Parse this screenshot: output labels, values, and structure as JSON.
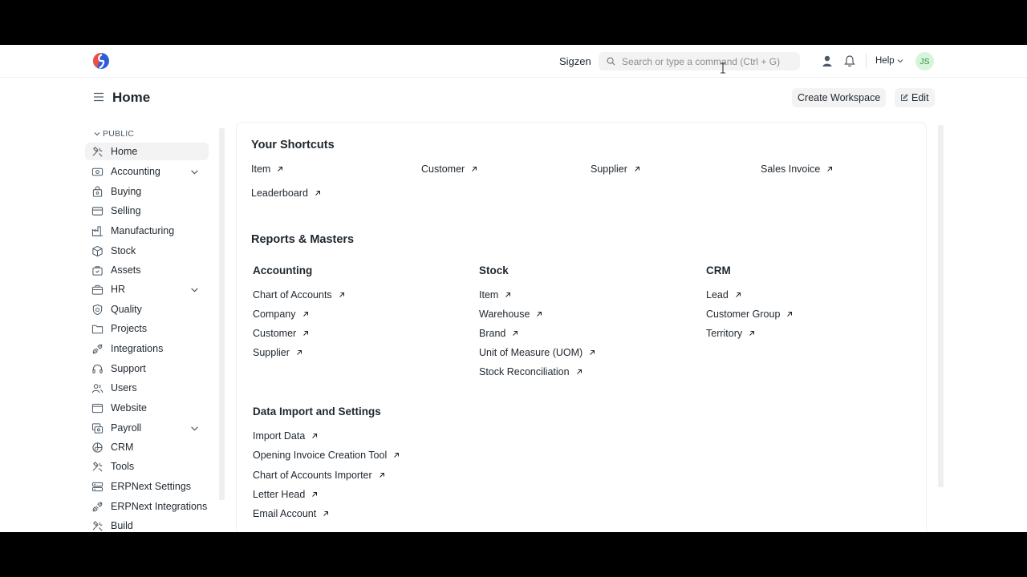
{
  "navbar": {
    "brand": "Sigzen",
    "search_placeholder": "Search or type a command (Ctrl + G)",
    "help_label": "Help",
    "avatar_initials": "JS"
  },
  "page": {
    "title": "Home",
    "create_workspace_label": "Create Workspace",
    "edit_label": "Edit"
  },
  "sidebar": {
    "section_label": "PUBLIC",
    "items": [
      {
        "label": "Home",
        "icon": "tools-icon",
        "active": true
      },
      {
        "label": "Accounting",
        "icon": "accounting-icon",
        "expandable": true
      },
      {
        "label": "Buying",
        "icon": "buying-icon"
      },
      {
        "label": "Selling",
        "icon": "selling-icon"
      },
      {
        "label": "Manufacturing",
        "icon": "factory-icon"
      },
      {
        "label": "Stock",
        "icon": "stock-icon"
      },
      {
        "label": "Assets",
        "icon": "assets-icon"
      },
      {
        "label": "HR",
        "icon": "hr-icon",
        "expandable": true
      },
      {
        "label": "Quality",
        "icon": "quality-icon"
      },
      {
        "label": "Projects",
        "icon": "folder-icon"
      },
      {
        "label": "Integrations",
        "icon": "integrations-icon"
      },
      {
        "label": "Support",
        "icon": "headset-icon"
      },
      {
        "label": "Users",
        "icon": "users-icon"
      },
      {
        "label": "Website",
        "icon": "website-icon"
      },
      {
        "label": "Payroll",
        "icon": "payroll-icon",
        "expandable": true
      },
      {
        "label": "CRM",
        "icon": "crm-icon"
      },
      {
        "label": "Tools",
        "icon": "tools-icon"
      },
      {
        "label": "ERPNext Settings",
        "icon": "settings-icon"
      },
      {
        "label": "ERPNext Integrations",
        "icon": "integrations-icon"
      },
      {
        "label": "Build",
        "icon": "build-icon"
      }
    ]
  },
  "shortcuts": {
    "title": "Your Shortcuts",
    "items": [
      "Item",
      "Customer",
      "Supplier",
      "Sales Invoice",
      "Leaderboard"
    ]
  },
  "reports": {
    "title": "Reports & Masters",
    "columns": [
      {
        "title": "Accounting",
        "links": [
          "Chart of Accounts",
          "Company",
          "Customer",
          "Supplier"
        ]
      },
      {
        "title": "Stock",
        "links": [
          "Item",
          "Warehouse",
          "Brand",
          "Unit of Measure (UOM)",
          "Stock Reconciliation"
        ]
      },
      {
        "title": "CRM",
        "links": [
          "Lead",
          "Customer Group",
          "Territory"
        ]
      },
      {
        "title": "Data Import and Settings",
        "links": [
          "Import Data",
          "Opening Invoice Creation Tool",
          "Chart of Accounts Importer",
          "Letter Head",
          "Email Account"
        ]
      }
    ]
  },
  "colors": {
    "accent": "#2490ef",
    "logo_red": "#f04e3e",
    "logo_blue": "#2f5cdb",
    "avatar_bg": "#d6f5da",
    "avatar_text": "#3a8c46"
  }
}
